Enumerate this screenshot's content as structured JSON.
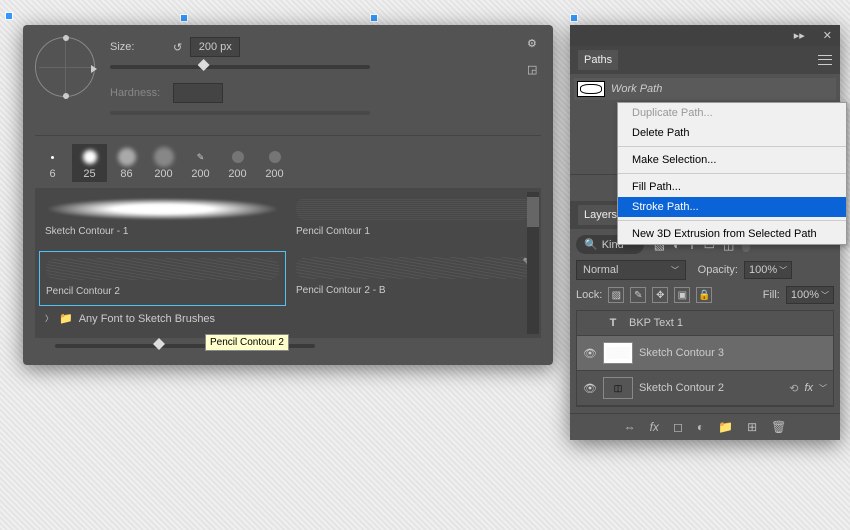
{
  "brush": {
    "size_label": "Size:",
    "size_value": "200 px",
    "hardness_label": "Hardness:",
    "hardness_value": "",
    "sizes": [
      "6",
      "25",
      "86",
      "200",
      "200",
      "200",
      "200"
    ],
    "brushes": [
      {
        "name": "Sketch Contour - 1"
      },
      {
        "name": "Pencil Contour 1"
      },
      {
        "name": "Pencil Contour 2"
      },
      {
        "name": "Pencil Contour 2 - B"
      }
    ],
    "folder": "Any Font to Sketch Brushes",
    "tooltip": "Pencil Contour 2"
  },
  "paths": {
    "title": "Paths",
    "item": "Work Path"
  },
  "context": {
    "dup": "Duplicate Path...",
    "del": "Delete Path",
    "make": "Make Selection...",
    "fill": "Fill Path...",
    "stroke": "Stroke Path...",
    "extrude": "New 3D Extrusion from Selected Path"
  },
  "layers": {
    "title": "Layers",
    "kind": "Kind",
    "blend": "Normal",
    "opacity_label": "Opacity:",
    "opacity": "100%",
    "lock_label": "Lock:",
    "fill_label": "Fill:",
    "fill": "100%",
    "items": [
      {
        "name": "BKP Text 1",
        "type": "T"
      },
      {
        "name": "Sketch Contour 3",
        "type": "img"
      },
      {
        "name": "Sketch Contour 2",
        "type": "smart"
      }
    ]
  }
}
